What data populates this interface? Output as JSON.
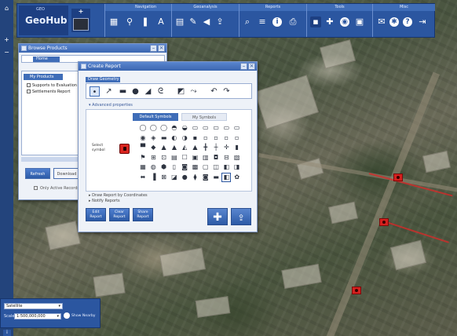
{
  "colors": {
    "toolbar": "#2b56a0",
    "accent": "#3f6db8",
    "marker": "#d4201e",
    "window_bg": "#eef2f8"
  },
  "leftstrip": {
    "icons": [
      "home-icon",
      "zoom-in-icon",
      "zoom-out-icon"
    ]
  },
  "logo": {
    "brand_top": "GEO",
    "brand": "GeoHub"
  },
  "toolbar": {
    "plus": "+",
    "groups": [
      {
        "title": "Navigation"
      },
      {
        "title": "Geoanalysis"
      },
      {
        "title": "Reports"
      },
      {
        "title": "Tools"
      },
      {
        "title": "Misc"
      }
    ]
  },
  "browse": {
    "title": "Browse Products",
    "address_pill": "Home",
    "tree_header": "My Products",
    "rows": [
      "Supports to Evaluation / Analysis",
      "Settlements Report"
    ],
    "page_strip": "Page 1",
    "buttons": {
      "primary": "Refresh",
      "plain": "Download"
    },
    "checkbox": "Only Active Records"
  },
  "create": {
    "title": "Create Report",
    "draw_label": "Draw Geometry",
    "advanced": "Advanced properties",
    "tabs": [
      "Default Symbols",
      "My Symbols"
    ],
    "symbol_label": "Select symbol",
    "options": [
      "Draw Report by Coordinates",
      "Notify Reports"
    ],
    "buttons": [
      "Edit Report",
      "Clear Report",
      "Share Report"
    ],
    "big_buttons": [
      "add-icon",
      "upload-icon"
    ]
  },
  "basemap": {
    "layer": "Satellite",
    "scale_label": "Scale",
    "scale": "1:500,000,000",
    "scale_note": "Show Nearby"
  }
}
